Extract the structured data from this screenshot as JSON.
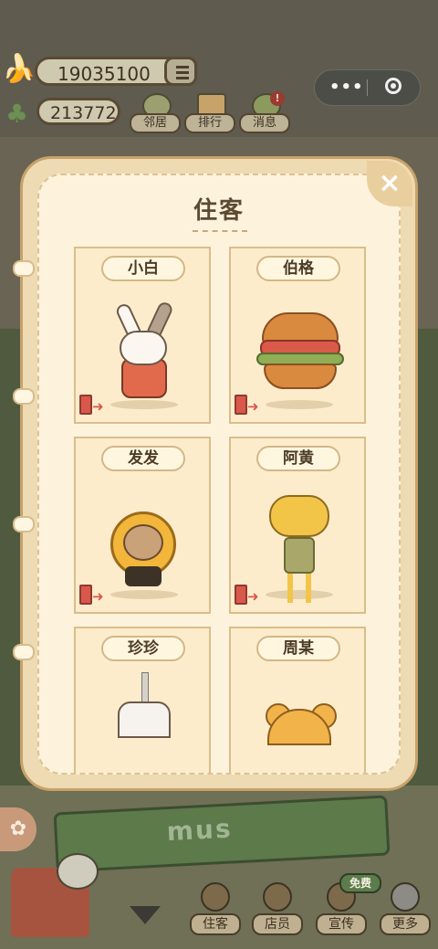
{
  "top": {
    "coins": "19035100",
    "leaves": "213772",
    "nav": [
      {
        "label": "邻居",
        "icon": "neighbor-icon"
      },
      {
        "label": "排行",
        "icon": "ranking-icon"
      },
      {
        "label": "消息",
        "icon": "message-icon",
        "badge": "!"
      }
    ]
  },
  "modal": {
    "title": "住客",
    "close": "×",
    "residents": [
      {
        "name": "小白"
      },
      {
        "name": "伯格"
      },
      {
        "name": "发发"
      },
      {
        "name": "阿黄"
      },
      {
        "name": "珍珍"
      },
      {
        "name": "周某"
      }
    ]
  },
  "scene": {
    "banner_text": "mus"
  },
  "bottom": {
    "free_badge": "免费",
    "nav": [
      {
        "label": "住客",
        "icon": "resident-icon"
      },
      {
        "label": "店员",
        "icon": "staff-icon"
      },
      {
        "label": "宣传",
        "icon": "promo-icon"
      },
      {
        "label": "更多",
        "icon": "more-icon"
      }
    ]
  }
}
